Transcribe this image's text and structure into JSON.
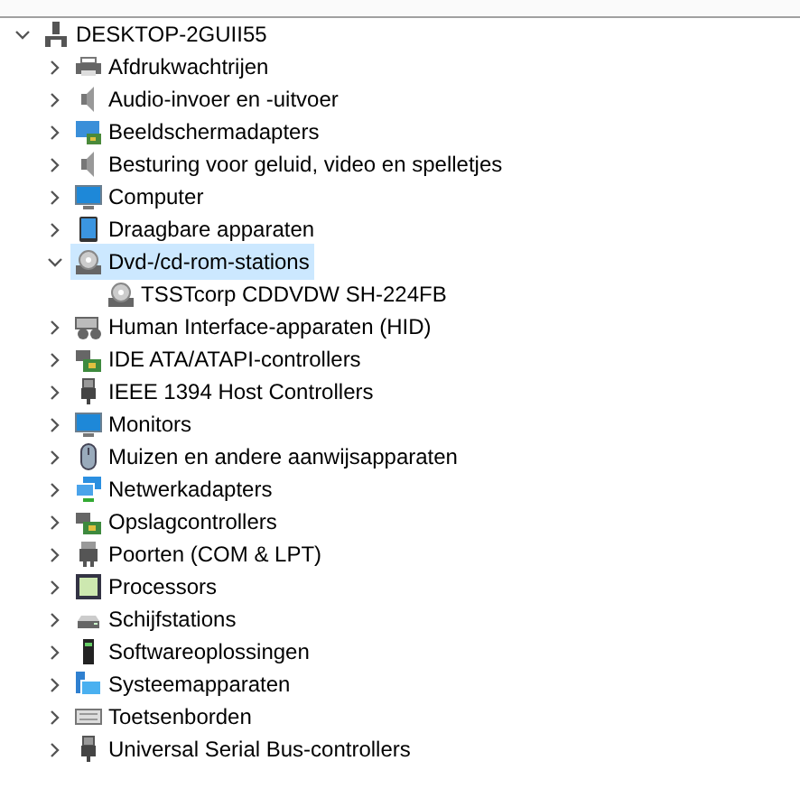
{
  "tree": {
    "label": "DESKTOP-2GUII55",
    "kind": "computer-root",
    "expanded": true,
    "selected": false,
    "children": [
      {
        "label": "Afdrukwachtrijen",
        "kind": "printer",
        "expanded": false,
        "selected": false
      },
      {
        "label": "Audio-invoer en -uitvoer",
        "kind": "speaker",
        "expanded": false,
        "selected": false
      },
      {
        "label": "Beeldschermadapters",
        "kind": "display-adapter",
        "expanded": false,
        "selected": false
      },
      {
        "label": "Besturing voor geluid, video en spelletjes",
        "kind": "speaker",
        "expanded": false,
        "selected": false
      },
      {
        "label": "Computer",
        "kind": "monitor",
        "expanded": false,
        "selected": false
      },
      {
        "label": "Draagbare apparaten",
        "kind": "tablet",
        "expanded": false,
        "selected": false
      },
      {
        "label": "Dvd-/cd-rom-stations",
        "kind": "disc",
        "expanded": true,
        "selected": true,
        "children": [
          {
            "label": "TSSTcorp CDDVDW SH-224FB",
            "kind": "disc",
            "selected": false
          }
        ]
      },
      {
        "label": "Human Interface-apparaten (HID)",
        "kind": "hid",
        "expanded": false,
        "selected": false
      },
      {
        "label": "IDE ATA/ATAPI-controllers",
        "kind": "card",
        "expanded": false,
        "selected": false
      },
      {
        "label": "IEEE 1394 Host Controllers",
        "kind": "plug",
        "expanded": false,
        "selected": false
      },
      {
        "label": "Monitors",
        "kind": "monitor",
        "expanded": false,
        "selected": false
      },
      {
        "label": "Muizen en andere aanwijsapparaten",
        "kind": "mouse",
        "expanded": false,
        "selected": false
      },
      {
        "label": "Netwerkadapters",
        "kind": "network",
        "expanded": false,
        "selected": false
      },
      {
        "label": "Opslagcontrollers",
        "kind": "card",
        "expanded": false,
        "selected": false
      },
      {
        "label": "Poorten (COM & LPT)",
        "kind": "port",
        "expanded": false,
        "selected": false
      },
      {
        "label": "Processors",
        "kind": "cpu",
        "expanded": false,
        "selected": false
      },
      {
        "label": "Schijfstations",
        "kind": "drive",
        "expanded": false,
        "selected": false
      },
      {
        "label": "Softwareoplossingen",
        "kind": "tower",
        "expanded": false,
        "selected": false
      },
      {
        "label": "Systeemapparaten",
        "kind": "system",
        "expanded": false,
        "selected": false
      },
      {
        "label": "Toetsenborden",
        "kind": "keyboard",
        "expanded": false,
        "selected": false
      },
      {
        "label": "Universal Serial Bus-controllers",
        "kind": "plug",
        "expanded": false,
        "selected": false
      }
    ]
  }
}
